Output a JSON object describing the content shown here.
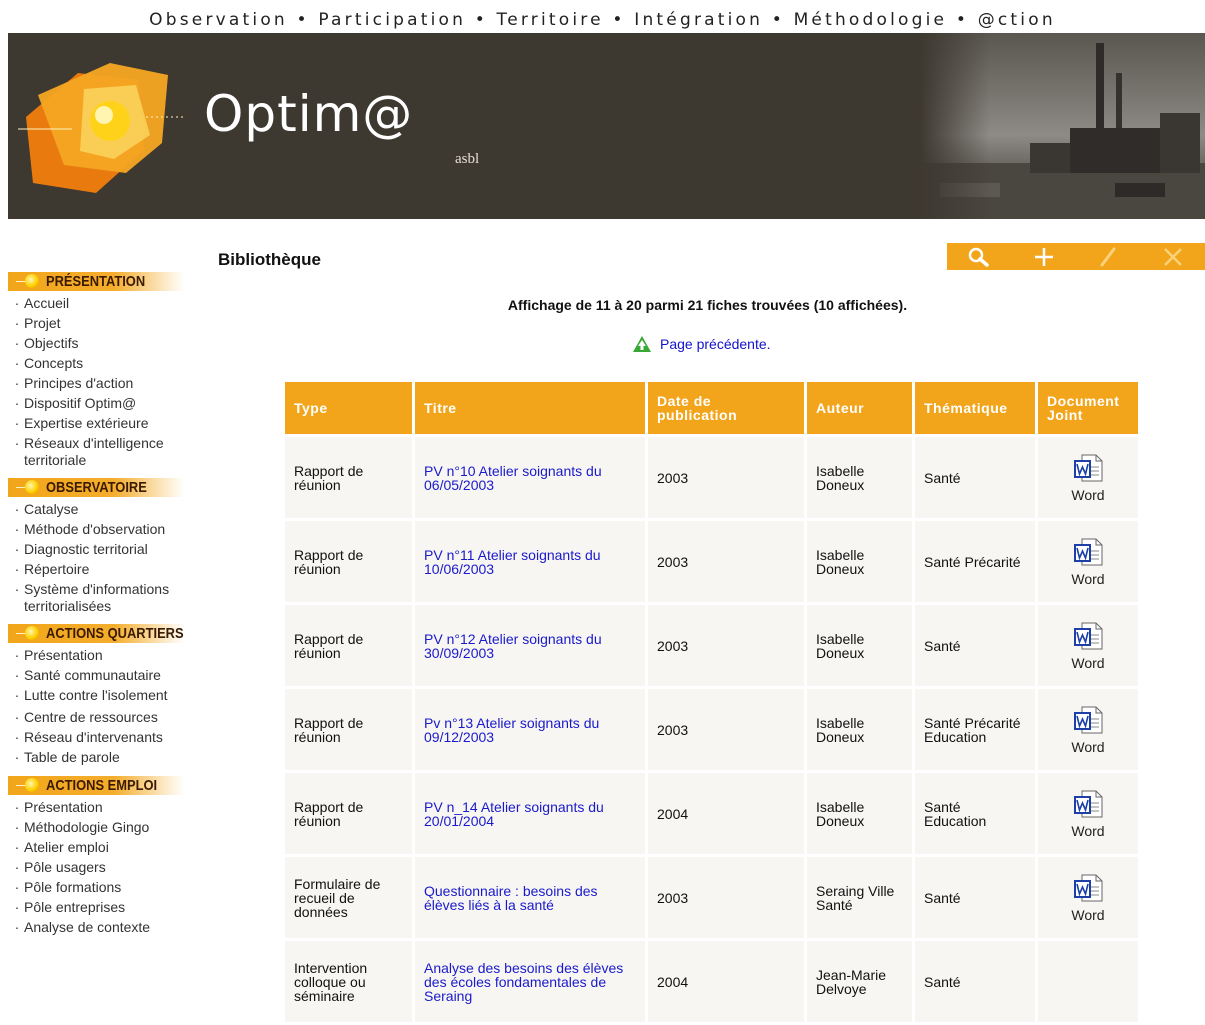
{
  "top_nav": [
    "Observation",
    "Participation",
    "Territoire",
    "Intégration",
    "Méthodologie",
    "@ction"
  ],
  "top_nav_separator": "•",
  "brand": {
    "name": "Optim@",
    "suffix": "asbl"
  },
  "sidebar": {
    "bullet": "·",
    "sections": [
      {
        "heading": "PRÉSENTATION",
        "items": [
          "Accueil",
          "Projet",
          "Objectifs",
          "Concepts",
          "Principes d'action",
          "Dispositif Optim@",
          "Expertise extérieure",
          "Réseaux d'intelligence territoriale"
        ]
      },
      {
        "heading": "OBSERVATOIRE",
        "items": [
          "Catalyse",
          "Méthode d'observation",
          "Diagnostic territorial",
          "Répertoire",
          "Système d'informations territorialisées"
        ]
      },
      {
        "heading": "ACTIONS QUARTIERS",
        "items": [
          "Présentation",
          "Santé communautaire",
          "Lutte contre l'isolement",
          "Centre de ressources",
          "Réseau d'intervenants",
          "Table de parole"
        ]
      },
      {
        "heading": "ACTIONS EMPLOI",
        "items": [
          "Présentation",
          "Méthodologie Gingo",
          "Atelier emploi",
          "Pôle usagers",
          "Pôle formations",
          "Pôle entreprises",
          "Analyse de contexte"
        ]
      }
    ]
  },
  "page_title": "Bibliothèque",
  "toolbar": {
    "icons": [
      "search-icon",
      "plus-icon",
      "pencil-icon",
      "close-icon"
    ]
  },
  "count_text": "Affichage de 11 à 20 parmi 21 fiches trouvées (10 affichées).",
  "prev_link": "Page précédente.",
  "table": {
    "headers": [
      "Type",
      "Titre",
      "Date de publication",
      "Auteur",
      "Thématique",
      "Document Joint"
    ],
    "rows": [
      {
        "type": "Rapport de réunion",
        "title": "PV n°10 Atelier soignants du 06/05/2003",
        "date": "2003",
        "author": "Isabelle Doneux",
        "theme": "Santé",
        "doc": "Word"
      },
      {
        "type": "Rapport de réunion",
        "title": "PV n°11 Atelier soignants du 10/06/2003",
        "date": "2003",
        "author": "Isabelle Doneux",
        "theme": "Santé Précarité",
        "doc": "Word"
      },
      {
        "type": "Rapport de réunion",
        "title": "PV n°12 Atelier soignants du 30/09/2003",
        "date": "2003",
        "author": "Isabelle Doneux",
        "theme": "Santé",
        "doc": "Word"
      },
      {
        "type": "Rapport de réunion",
        "title": "Pv n°13 Atelier soignants du 09/12/2003",
        "date": "2003",
        "author": "Isabelle Doneux",
        "theme": "Santé Précarité Education",
        "doc": "Word"
      },
      {
        "type": "Rapport de réunion",
        "title": "PV n_14 Atelier soignants du 20/01/2004",
        "date": "2004",
        "author": "Isabelle Doneux",
        "theme": "Santé Education",
        "doc": "Word"
      },
      {
        "type": "Formulaire de recueil de données",
        "title": "Questionnaire : besoins des élèves liés à la santé",
        "date": "2003",
        "author": "Seraing Ville Santé",
        "theme": "Santé",
        "doc": "Word"
      },
      {
        "type": "Intervention colloque ou séminaire",
        "title": "Analyse des besoins des élèves des écoles fondamentales de Seraing",
        "date": "2004",
        "author": "Jean-Marie Delvoye",
        "theme": "Santé",
        "doc": ""
      }
    ]
  },
  "colors": {
    "accent": "#f2a51a",
    "banner": "#3d3830",
    "link": "#1a1acc",
    "row_bg": "#f7f6f2"
  }
}
